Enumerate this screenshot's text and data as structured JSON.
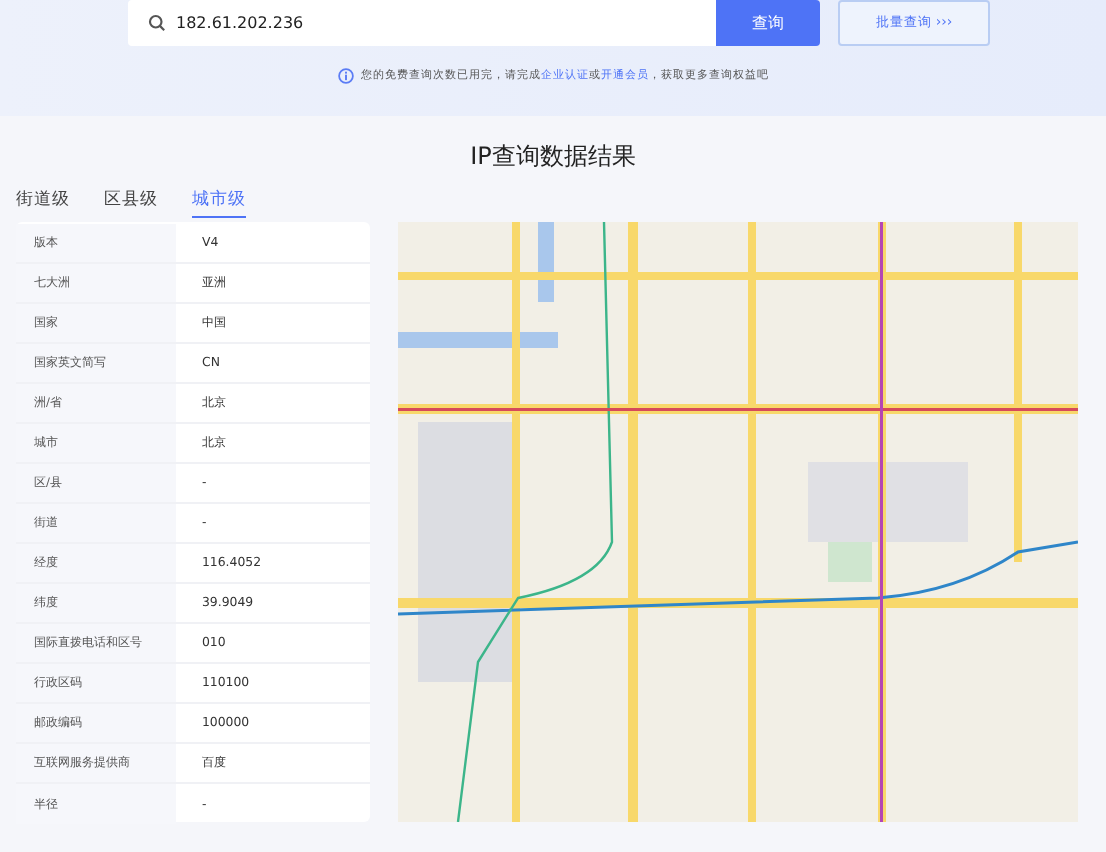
{
  "search": {
    "value": "182.61.202.236",
    "button": "查询",
    "batch_button": "批量查询",
    "batch_icon": "›››"
  },
  "notice": {
    "before": "您的免费查询次数已用完，请完成",
    "link1": "企业认证",
    "middle": "或",
    "link2": "开通会员",
    "after": "，获取更多查询权益吧"
  },
  "title": "IP查询数据结果",
  "tabs": [
    {
      "label": "街道级",
      "selected": false
    },
    {
      "label": "区县级",
      "selected": false
    },
    {
      "label": "城市级",
      "selected": true
    }
  ],
  "rows": [
    {
      "label": "版本",
      "value": "V4"
    },
    {
      "label": "七大洲",
      "value": "亚洲"
    },
    {
      "label": "国家",
      "value": "中国"
    },
    {
      "label": "国家英文简写",
      "value": "CN"
    },
    {
      "label": "洲/省",
      "value": "北京"
    },
    {
      "label": "城市",
      "value": "北京"
    },
    {
      "label": "区/县",
      "value": "-"
    },
    {
      "label": "街道",
      "value": "-"
    },
    {
      "label": "经度",
      "value": "116.4052"
    },
    {
      "label": "纬度",
      "value": "39.9049"
    },
    {
      "label": "国际直拨电话和区号",
      "value": "010"
    },
    {
      "label": "行政区码",
      "value": "110100"
    },
    {
      "label": "邮政编码",
      "value": "100000"
    },
    {
      "label": "互联网服务提供商",
      "value": "百度"
    },
    {
      "label": "半径",
      "value": "-"
    }
  ]
}
